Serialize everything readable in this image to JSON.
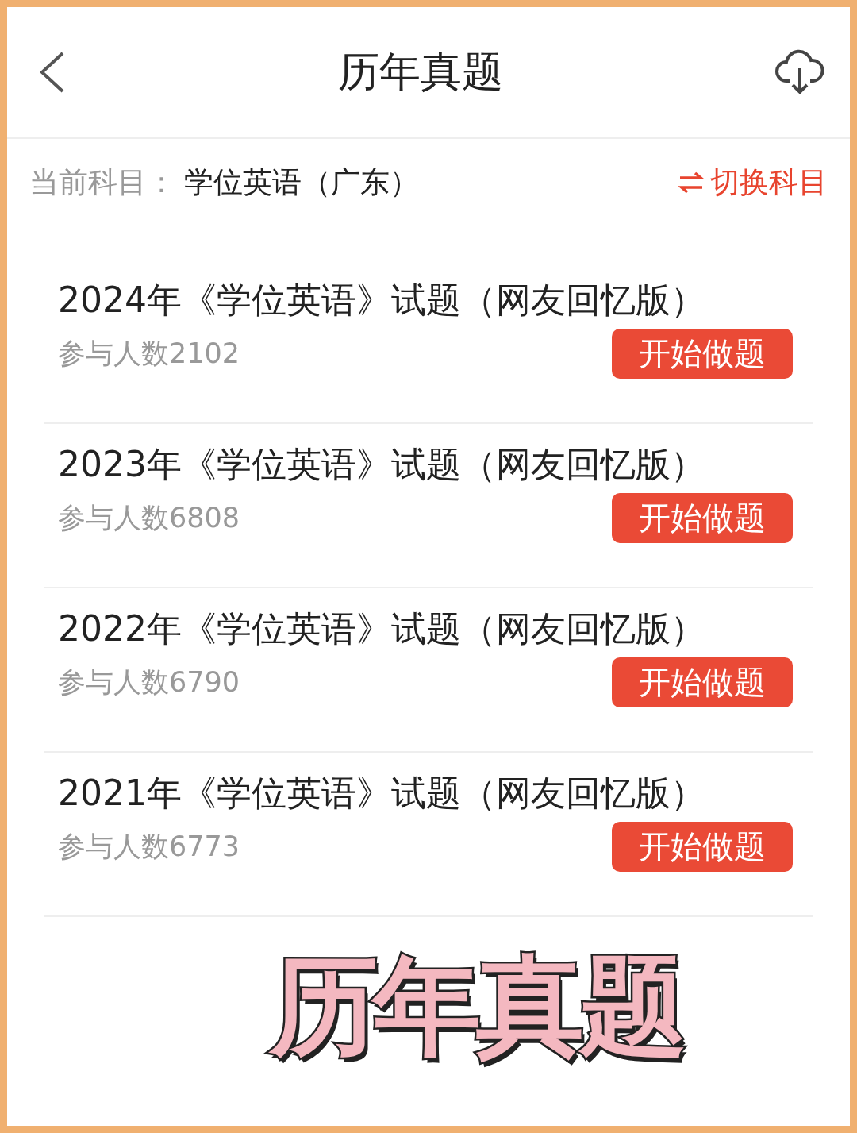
{
  "header": {
    "title": "历年真题"
  },
  "subject": {
    "label": "当前科目：",
    "value": "学位英语（广东）",
    "switch": "切换科目"
  },
  "papers": [
    {
      "title": "2024年《学位英语》试题（网友回忆版）",
      "participants": "参与人数2102",
      "button": "开始做题"
    },
    {
      "title": "2023年《学位英语》试题（网友回忆版）",
      "participants": "参与人数6808",
      "button": "开始做题"
    },
    {
      "title": "2022年《学位英语》试题（网友回忆版）",
      "participants": "参与人数6790",
      "button": "开始做题"
    },
    {
      "title": "2021年《学位英语》试题（网友回忆版）",
      "participants": "参与人数6773",
      "button": "开始做题"
    }
  ],
  "caption": "历年真题"
}
